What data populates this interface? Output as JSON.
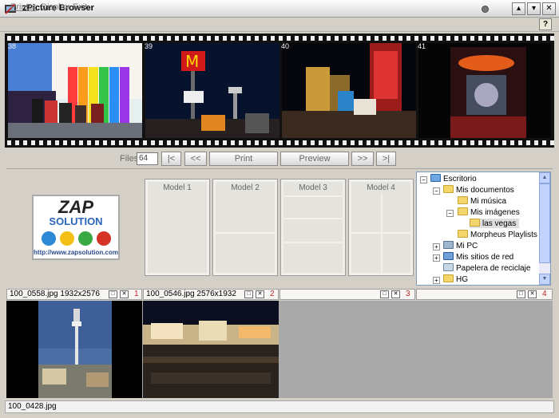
{
  "window": {
    "title": "zPicture Browser"
  },
  "menu": {
    "items": [
      "Printer",
      "Display",
      "Exit"
    ],
    "help": "?"
  },
  "filmstrip": {
    "frames": [
      {
        "number": "38",
        "scene": "casino interior"
      },
      {
        "number": "39",
        "scene": "mcdonalds sign at night"
      },
      {
        "number": "40",
        "scene": "las vegas strip at night"
      },
      {
        "number": "41",
        "scene": "hard rock cafe at night"
      }
    ]
  },
  "toolbar": {
    "files_label": "Files",
    "files_value": "64",
    "first_label": "|<",
    "prev_label": "<<",
    "print_label": "Print",
    "preview_label": "Preview",
    "next_label": ">>",
    "last_label": ">|"
  },
  "logo": {
    "line1": "ZAP",
    "line2": "SOLUTION",
    "url": "http://www.zapsolution.com"
  },
  "models": [
    {
      "label": "Model 1"
    },
    {
      "label": "Model 2"
    },
    {
      "label": "Model 3"
    },
    {
      "label": "Model 4"
    }
  ],
  "tree": {
    "items": [
      {
        "label": "Escritorio"
      },
      {
        "label": "Mis documentos"
      },
      {
        "label": "Mi música"
      },
      {
        "label": "Mis imágenes"
      },
      {
        "label": "las vegas"
      },
      {
        "label": "Morpheus Playlists"
      },
      {
        "label": "Mi PC"
      },
      {
        "label": "Mis sitios de red"
      },
      {
        "label": "Papelera de reciclaje"
      },
      {
        "label": "HG"
      }
    ]
  },
  "panes": [
    {
      "caption": "100_0558.jpg 1932x2576",
      "number": "1"
    },
    {
      "caption": "100_0546.jpg 2576x1932",
      "number": "2"
    },
    {
      "caption": "",
      "number": "3"
    },
    {
      "caption": "",
      "number": "4"
    }
  ],
  "status": {
    "text": "100_0428.jpg"
  },
  "colors": {
    "titlebar": "#eaeaea",
    "film": "#111111",
    "tree_folder": "#f3d56b",
    "pane_number": "#c0262a"
  }
}
